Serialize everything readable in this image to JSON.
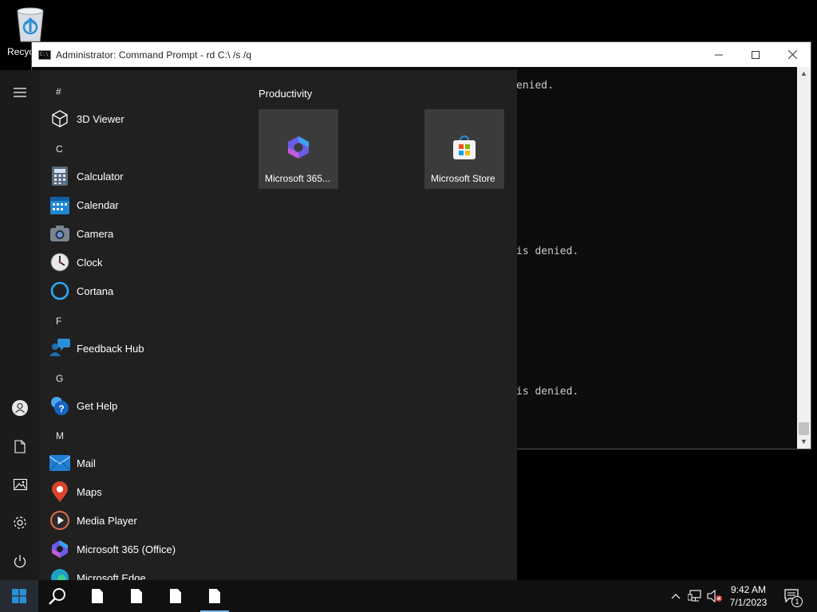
{
  "desktop": {
    "recycle_bin_label": "Recycle Bin"
  },
  "cmd": {
    "title": "Administrator:  Command Prompt - rd  C:\\ /s /q",
    "lines": [
      "enied.",
      "is denied.",
      "is denied."
    ]
  },
  "start_menu": {
    "rail": {
      "menu_icon": "hamburger-icon",
      "user_icon": "user-icon",
      "documents_icon": "document-icon",
      "pictures_icon": "pictures-icon",
      "settings_icon": "gear-icon",
      "power_icon": "power-icon"
    },
    "letters": [
      "#",
      "C",
      "F",
      "G",
      "M"
    ],
    "apps": [
      {
        "label": "3D Viewer",
        "icon": "cube-icon"
      },
      {
        "label": "Calculator",
        "icon": "calculator-icon"
      },
      {
        "label": "Calendar",
        "icon": "calendar-icon"
      },
      {
        "label": "Camera",
        "icon": "camera-icon"
      },
      {
        "label": "Clock",
        "icon": "clock-icon"
      },
      {
        "label": "Cortana",
        "icon": "cortana-icon"
      },
      {
        "label": "Feedback Hub",
        "icon": "feedback-icon"
      },
      {
        "label": "Get Help",
        "icon": "help-icon"
      },
      {
        "label": "Mail",
        "icon": "mail-icon"
      },
      {
        "label": "Maps",
        "icon": "map-pin-icon"
      },
      {
        "label": "Media Player",
        "icon": "media-player-icon"
      },
      {
        "label": "Microsoft 365 (Office)",
        "icon": "m365-icon"
      },
      {
        "label": "Microsoft Edge",
        "icon": "edge-icon"
      }
    ],
    "tiles_header": "Productivity",
    "tiles": [
      {
        "label": "Microsoft 365...",
        "icon": "m365-icon"
      },
      {
        "label": "Microsoft Store",
        "icon": "store-icon"
      }
    ]
  },
  "taskbar": {
    "start_icon": "windows-logo-icon",
    "search_icon": "search-icon",
    "tray": {
      "chevron_icon": "chevron-up-icon",
      "network_icon": "network-icon",
      "volume_icon": "volume-muted-icon",
      "notification_icon": "notification-icon",
      "notification_count": "1"
    },
    "time": "9:42 AM",
    "date": "7/1/2023"
  },
  "colors": {
    "accent": "#0078d4",
    "start_bg": "#202020",
    "tile_bg": "#3b3b3b",
    "taskbar_bg": "#101010"
  }
}
